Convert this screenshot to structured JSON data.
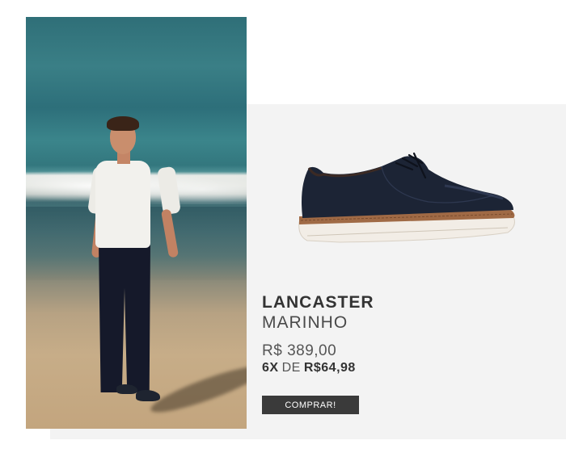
{
  "product": {
    "name": "LANCASTER",
    "color": "MARINHO",
    "price": "R$ 389,00",
    "installments": {
      "count": "6X",
      "connector": "DE",
      "amount": "R$64,98"
    },
    "buy_button": "COMPRAR!"
  },
  "colors": {
    "panel_background": "#f3f3f3",
    "button_background": "#3a3a3a",
    "shoe_upper": "#1c2435",
    "shoe_midsole": "#a06a45",
    "shoe_outsole": "#f2ede6"
  },
  "media": {
    "lifestyle_photo": "man-on-beach-photo",
    "product_image": "navy-derby-shoe"
  }
}
